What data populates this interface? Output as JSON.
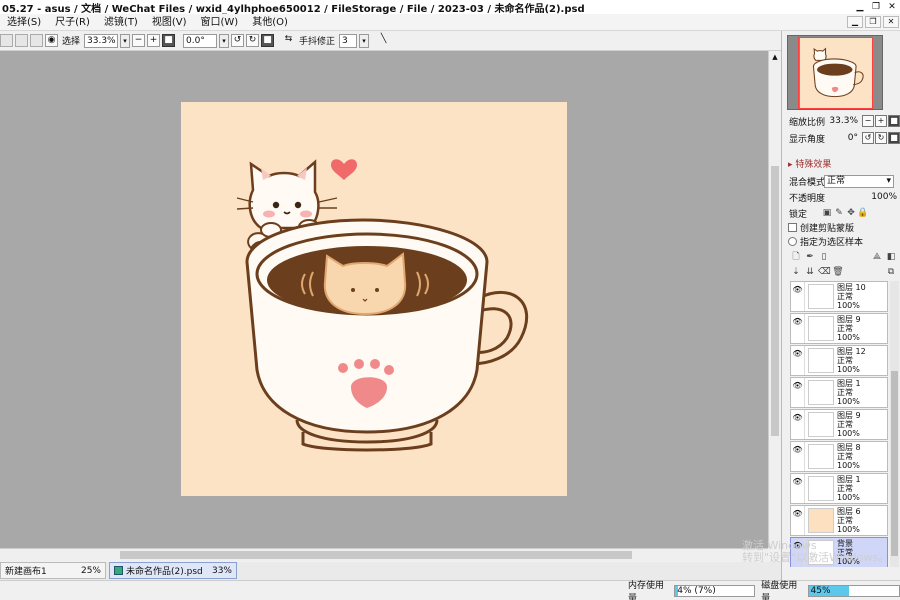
{
  "title": "05.27 - asus / 文档 / WeChat Files / wxid_4ylhphoe650012 / FileStorage / File / 2023-03 / 未命名作品(2).psd",
  "window_buttons": [
    "▁",
    "❐",
    "✕"
  ],
  "menu": [
    {
      "label": "选择(S)"
    },
    {
      "label": "尺子(R)"
    },
    {
      "label": "滤镜(T)"
    },
    {
      "label": "视图(V)"
    },
    {
      "label": "窗口(W)"
    },
    {
      "label": "其他(O)"
    }
  ],
  "mdi_buttons": [
    "▁",
    "❐",
    "✕"
  ],
  "toolbar": {
    "select_label": "选择",
    "zoom_value": "33.3%",
    "rotation_value": "0.0°",
    "stabilizer_label": "手抖修正",
    "stabilizer_value": "3"
  },
  "navigator": {
    "zoom_label": "缩放比例",
    "zoom_value": "33.3%",
    "angle_label": "显示角度",
    "angle_value": "0°"
  },
  "layer_panel": {
    "effects_label": "特殊效果",
    "blend_label": "混合模式",
    "blend_value": "正常",
    "opacity_label": "不透明度",
    "opacity_value": "100%",
    "lock_label": "锁定",
    "clip_label": "创建剪贴蒙版",
    "selection_source_label": "指定为选区样本"
  },
  "layers": [
    {
      "name": "图层 10",
      "mode": "正常",
      "opacity": "100%",
      "thumb": "#ffffff",
      "selected": false
    },
    {
      "name": "图层 9",
      "mode": "正常",
      "opacity": "100%",
      "thumb": "#ffffff",
      "selected": false
    },
    {
      "name": "图层 12",
      "mode": "正常",
      "opacity": "100%",
      "thumb": "#ffffff",
      "selected": false
    },
    {
      "name": "图层 1",
      "mode": "正常",
      "opacity": "100%",
      "thumb": "#ffffff",
      "selected": false
    },
    {
      "name": "图层 9",
      "mode": "正常",
      "opacity": "100%",
      "thumb": "#ffffff",
      "selected": false
    },
    {
      "name": "图层 8",
      "mode": "正常",
      "opacity": "100%",
      "thumb": "#ffffff",
      "selected": false
    },
    {
      "name": "图层 1",
      "mode": "正常",
      "opacity": "100%",
      "thumb": "#ffffff",
      "selected": false
    },
    {
      "name": "图层 6",
      "mode": "正常",
      "opacity": "100%",
      "thumb": "#fde0c0",
      "selected": false
    },
    {
      "name": "背景",
      "mode": "正常",
      "opacity": "100%",
      "thumb": "#ffffff",
      "selected": true
    }
  ],
  "tabs": [
    {
      "name": "新建画布1",
      "zoom": "25%",
      "active": false
    },
    {
      "name": "未命名作品(2).psd",
      "zoom": "33%",
      "active": true
    }
  ],
  "status": {
    "memory_label": "内存使用量",
    "memory_value": "4% (7%)",
    "memory_fraction": 0.04,
    "disk_label": "磁盘使用量",
    "disk_value": "45%",
    "disk_fraction": 0.45
  },
  "watermark": "激活 Windows\n转到\"设置\"以激活Windows。",
  "colors": {
    "canvas_bg": "#fde3c6",
    "workspace": "#a8a8a8",
    "coffee": "#6b3f1d",
    "paw": "#f08a8a",
    "accent": "#5cc8ec"
  }
}
